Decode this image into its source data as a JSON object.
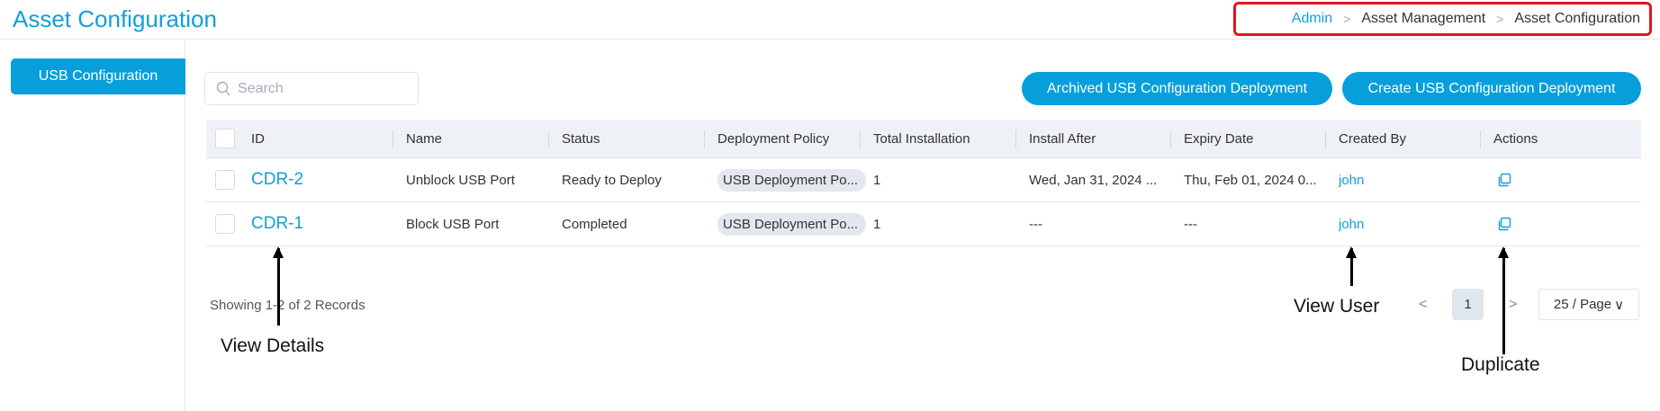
{
  "header": {
    "title": "Asset Configuration",
    "breadcrumb": [
      "Admin",
      "Asset Management",
      "Asset Configuration"
    ]
  },
  "sidebar": {
    "items": [
      {
        "label": "USB Configuration",
        "active": true
      }
    ]
  },
  "toolbar": {
    "search_placeholder": "Search",
    "archived_button": "Archived USB Configuration Deployment",
    "create_button": "Create USB Configuration Deployment"
  },
  "table": {
    "columns": [
      "ID",
      "Name",
      "Status",
      "Deployment Policy",
      "Total Installation",
      "Install After",
      "Expiry Date",
      "Created By",
      "Actions"
    ],
    "rows": [
      {
        "id": "CDR-2",
        "name": "Unblock USB Port",
        "status": "Ready to Deploy",
        "policy": "USB Deployment Po...",
        "total": "1",
        "install_after": "Wed, Jan 31, 2024 ...",
        "expiry": "Thu, Feb 01, 2024 0...",
        "created_by": "john",
        "action_icon": "duplicate-icon"
      },
      {
        "id": "CDR-1",
        "name": "Block USB Port",
        "status": "Completed",
        "policy": "USB Deployment Po...",
        "total": "1",
        "install_after": "---",
        "expiry": "---",
        "created_by": "john",
        "action_icon": "duplicate-icon"
      }
    ]
  },
  "pagination": {
    "summary": "Showing 1-2 of 2 Records",
    "prev": "<",
    "current_page": "1",
    "next": ">",
    "page_size": "25 / Page"
  },
  "annotations": {
    "view_details": "View Details",
    "view_user": "View User",
    "duplicate": "Duplicate"
  },
  "colors": {
    "accent": "#069fdc",
    "highlight_box": "#e0151b"
  }
}
